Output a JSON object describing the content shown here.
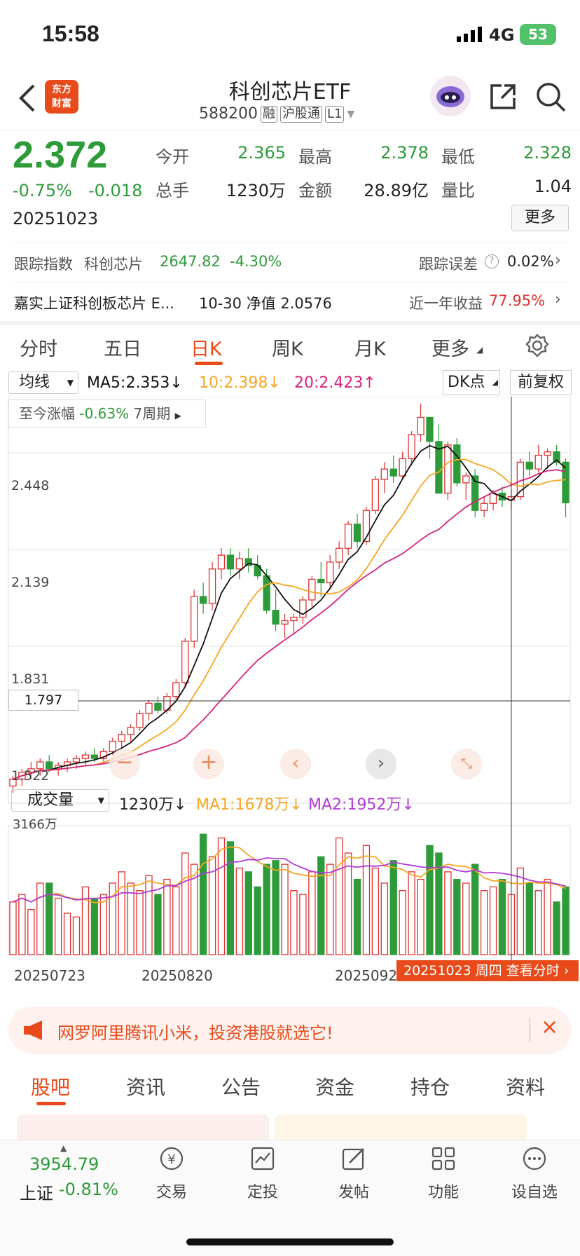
{
  "status": {
    "time": "15:58",
    "network": "4G",
    "battery": "53"
  },
  "nav": {
    "logo_line1": "东方",
    "logo_line2": "财富",
    "title": "科创芯片ETF",
    "code": "588200",
    "chip_rong": "融",
    "chip_hgt": "沪股通",
    "chip_l1": "L1"
  },
  "quote": {
    "price": "2.372",
    "change_pct": "-0.75%",
    "change": "-0.018",
    "date": "20251023",
    "open_label": "今开",
    "open": "2.365",
    "high_label": "最高",
    "high": "2.378",
    "low_label": "最低",
    "low": "2.328",
    "volume_label": "总手",
    "volume": "1230万",
    "amount_label": "金额",
    "amount": "28.89亿",
    "ratio_label": "量比",
    "ratio": "1.04",
    "more_button": "更多"
  },
  "tracking": {
    "label": "跟踪指数",
    "index_name": "科创芯片",
    "index_value": "2647.82",
    "index_change": "-4.30%",
    "error_label": "跟踪误差",
    "error_value": "0.02%"
  },
  "fund": {
    "name": "嘉实上证科创板芯片 E...",
    "nav_text": "10-30 净值 2.0576",
    "yearly_label": "近一年收益",
    "yearly_value": "77.95%"
  },
  "k_tabs": [
    "分时",
    "五日",
    "日K",
    "周K",
    "月K",
    "更多"
  ],
  "k_tab_active": 2,
  "ma": {
    "select": "均线",
    "ma5": "MA5:2.353↓",
    "ma10": "10:2.398↓",
    "ma20": "20:2.423↑",
    "dk_button": "DK点",
    "adjust_button": "前复权"
  },
  "range_box": {
    "label": "至今涨幅",
    "value": "-0.63%",
    "period": "7周期"
  },
  "price_axis": [
    "2.448",
    "2.139",
    "1.831",
    "1.522"
  ],
  "crosshair_price": "1.797",
  "chart_tool_icons": [
    "minus-icon",
    "plus-icon",
    "left-arrow-icon",
    "right-arrow-icon",
    "expand-icon"
  ],
  "volume": {
    "select": "成交量",
    "current": "1230万↓",
    "ma1": "MA1:1678万↓",
    "ma2": "MA2:1952万↓",
    "max_label": "3166万"
  },
  "date_axis": [
    "20250723",
    "20250820",
    "20250922"
  ],
  "crosshair_date_label": "20251023 周四 查看分时",
  "banner": {
    "text": "网罗阿里腾讯小米，投资港股就选它!"
  },
  "bottom_tabs": [
    "股吧",
    "资讯",
    "公告",
    "资金",
    "持仓",
    "资料"
  ],
  "bottom_tab_active": 0,
  "tabbar": {
    "index_value": "3954.79",
    "index_name": "上证",
    "index_change": "-0.81%",
    "items": [
      "交易",
      "定投",
      "发帖",
      "功能",
      "设自选"
    ]
  },
  "colors": {
    "up": "#e03131",
    "down": "#2e9b3a",
    "accent": "#e05a10",
    "ma5": "#111111",
    "ma10": "#f5a623",
    "ma20": "#d6247d"
  },
  "chart_data": {
    "type": "candlestick",
    "candles": [
      [
        1.55,
        1.58,
        1.53,
        1.57
      ],
      [
        1.57,
        1.6,
        1.55,
        1.59
      ],
      [
        1.59,
        1.62,
        1.57,
        1.6
      ],
      [
        1.6,
        1.63,
        1.58,
        1.62
      ],
      [
        1.62,
        1.64,
        1.59,
        1.6
      ],
      [
        1.6,
        1.62,
        1.58,
        1.61
      ],
      [
        1.61,
        1.63,
        1.59,
        1.62
      ],
      [
        1.62,
        1.64,
        1.6,
        1.63
      ],
      [
        1.63,
        1.65,
        1.61,
        1.64
      ],
      [
        1.64,
        1.66,
        1.62,
        1.63
      ],
      [
        1.63,
        1.66,
        1.62,
        1.65
      ],
      [
        1.65,
        1.69,
        1.64,
        1.68
      ],
      [
        1.68,
        1.71,
        1.66,
        1.7
      ],
      [
        1.7,
        1.73,
        1.68,
        1.72
      ],
      [
        1.72,
        1.77,
        1.71,
        1.76
      ],
      [
        1.76,
        1.8,
        1.74,
        1.79
      ],
      [
        1.79,
        1.81,
        1.76,
        1.77
      ],
      [
        1.77,
        1.82,
        1.76,
        1.81
      ],
      [
        1.81,
        1.86,
        1.8,
        1.85
      ],
      [
        1.85,
        1.98,
        1.84,
        1.97
      ],
      [
        1.97,
        2.12,
        1.95,
        2.1
      ],
      [
        2.1,
        2.14,
        2.05,
        2.08
      ],
      [
        2.08,
        2.2,
        2.06,
        2.18
      ],
      [
        2.18,
        2.24,
        2.15,
        2.22
      ],
      [
        2.22,
        2.24,
        2.16,
        2.18
      ],
      [
        2.18,
        2.23,
        2.15,
        2.21
      ],
      [
        2.21,
        2.24,
        2.17,
        2.19
      ],
      [
        2.19,
        2.22,
        2.15,
        2.16
      ],
      [
        2.16,
        2.18,
        2.05,
        2.06
      ],
      [
        2.06,
        2.12,
        2.0,
        2.02
      ],
      [
        2.02,
        2.05,
        1.98,
        2.03
      ],
      [
        2.03,
        2.05,
        1.99,
        2.04
      ],
      [
        2.04,
        2.1,
        2.02,
        2.09
      ],
      [
        2.09,
        2.16,
        2.07,
        2.15
      ],
      [
        2.15,
        2.2,
        2.1,
        2.14
      ],
      [
        2.14,
        2.22,
        2.12,
        2.2
      ],
      [
        2.2,
        2.26,
        2.18,
        2.24
      ],
      [
        2.24,
        2.32,
        2.22,
        2.31
      ],
      [
        2.31,
        2.34,
        2.24,
        2.26
      ],
      [
        2.26,
        2.36,
        2.25,
        2.35
      ],
      [
        2.35,
        2.45,
        2.34,
        2.44
      ],
      [
        2.44,
        2.49,
        2.4,
        2.47
      ],
      [
        2.47,
        2.51,
        2.43,
        2.45
      ],
      [
        2.45,
        2.52,
        2.44,
        2.5
      ],
      [
        2.5,
        2.58,
        2.48,
        2.57
      ],
      [
        2.57,
        2.66,
        2.55,
        2.62
      ],
      [
        2.62,
        2.6,
        2.5,
        2.55
      ],
      [
        2.55,
        2.6,
        2.45,
        2.4
      ],
      [
        2.4,
        2.55,
        2.38,
        2.54
      ],
      [
        2.54,
        2.56,
        2.42,
        2.43
      ],
      [
        2.43,
        2.46,
        2.38,
        2.45
      ],
      [
        2.45,
        2.47,
        2.33,
        2.35
      ],
      [
        2.35,
        2.39,
        2.33,
        2.37
      ],
      [
        2.37,
        2.41,
        2.35,
        2.4
      ],
      [
        2.4,
        2.42,
        2.36,
        2.38
      ],
      [
        2.38,
        2.41,
        2.35,
        2.39
      ],
      [
        2.39,
        2.5,
        2.38,
        2.49
      ],
      [
        2.49,
        2.52,
        2.45,
        2.47
      ],
      [
        2.47,
        2.54,
        2.46,
        2.51
      ],
      [
        2.51,
        2.53,
        2.47,
        2.52
      ],
      [
        2.52,
        2.54,
        2.48,
        2.49
      ],
      [
        2.49,
        2.5,
        2.33,
        2.372
      ]
    ],
    "volumes": [
      14,
      16,
      12,
      19,
      19,
      15,
      11,
      10,
      18,
      15,
      16,
      19,
      22,
      19,
      17,
      21,
      16,
      20,
      18,
      27,
      24,
      32,
      26,
      31,
      30,
      23,
      22,
      18,
      24,
      25,
      24,
      17,
      16,
      22,
      26,
      24,
      31,
      27,
      20,
      29,
      23,
      19,
      25,
      17,
      22,
      20,
      29,
      27,
      22,
      20,
      19,
      24,
      17,
      18,
      20,
      16,
      23,
      19,
      17,
      20,
      14,
      18
    ],
    "ylim": [
      1.5,
      2.68
    ],
    "volume_max": 31.66
  }
}
